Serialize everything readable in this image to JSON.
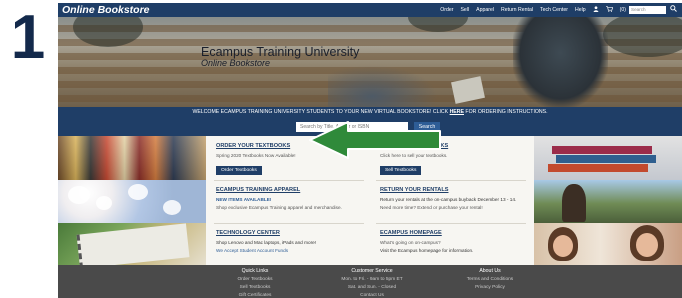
{
  "step_number": "1",
  "nav": {
    "logo": "Online Bookstore",
    "links": [
      "Order",
      "Sell",
      "Apparel",
      "Return Rental",
      "Tech Center",
      "Help"
    ],
    "cart_count": "(0)",
    "search_placeholder": "Search"
  },
  "hero": {
    "title": "Ecampus Training University",
    "subtitle": "Online Bookstore"
  },
  "announcement": {
    "text_before": "WELCOME ECAMPUS TRAINING UNIVERSITY STUDENTS TO YOUR NEW VIRTUAL BOOKSTORE! CLICK ",
    "link": "HERE",
    "text_after": " FOR ORDERING INSTRUCTIONS."
  },
  "search": {
    "placeholder": "Search by Title, Author or ISBN",
    "button": "Search"
  },
  "left_column": [
    {
      "title": "ORDER YOUR TEXTBOOKS",
      "text": "Spring 2020 Textbooks Now Available!",
      "button": "Order Textbooks"
    },
    {
      "title": "ECAMPUS TRAINING APPAREL",
      "text_link": "NEW ITEMS AVAILABLE!",
      "text": "Shop exclusive Ecampus Training apparel and merchandise."
    },
    {
      "title": "TECHNOLOGY CENTER",
      "text_bold": "Shop Lenovo and Mac laptops, iPads and more!",
      "text_link": "We Accept Student Account Funds"
    }
  ],
  "right_column": [
    {
      "title": "SELL YOUR TEXTBOOKS",
      "text": "Click here to sell your textbooks.",
      "button": "Sell Textbooks"
    },
    {
      "title": "RETURN YOUR RENTALS",
      "text_bold": "Return your rentals at the on-campus buyback December 13 - 14.",
      "text": "Need more time? Extend or purchase your rental!"
    },
    {
      "title": "ECAMPUS HOMEPAGE",
      "text": "What's going on on-campus?",
      "text_bold": "Visit the Ecampus homepage for information."
    }
  ],
  "footer": {
    "quick_links": {
      "heading": "Quick Links",
      "items": [
        "Order Textbooks",
        "Sell Textbooks",
        "Gift Certificates"
      ]
    },
    "customer_service": {
      "heading": "Customer Service",
      "items": [
        "Mon. to Fri. - 9am to 5pm ET",
        "Sat. and Sun. - Closed",
        "Contact Us"
      ]
    },
    "about_us": {
      "heading": "About Us",
      "items": [
        "Terms and Conditions",
        "Privacy Policy"
      ]
    }
  },
  "colors": {
    "navy": "#1f3e67",
    "button_blue": "#2e5d96",
    "arrow_green": "#2f8a3a",
    "footer": "#4a4a4a",
    "step_number": "#13294b"
  },
  "icons": [
    "user-icon",
    "cart-icon",
    "search-icon",
    "arrow-left-icon"
  ]
}
